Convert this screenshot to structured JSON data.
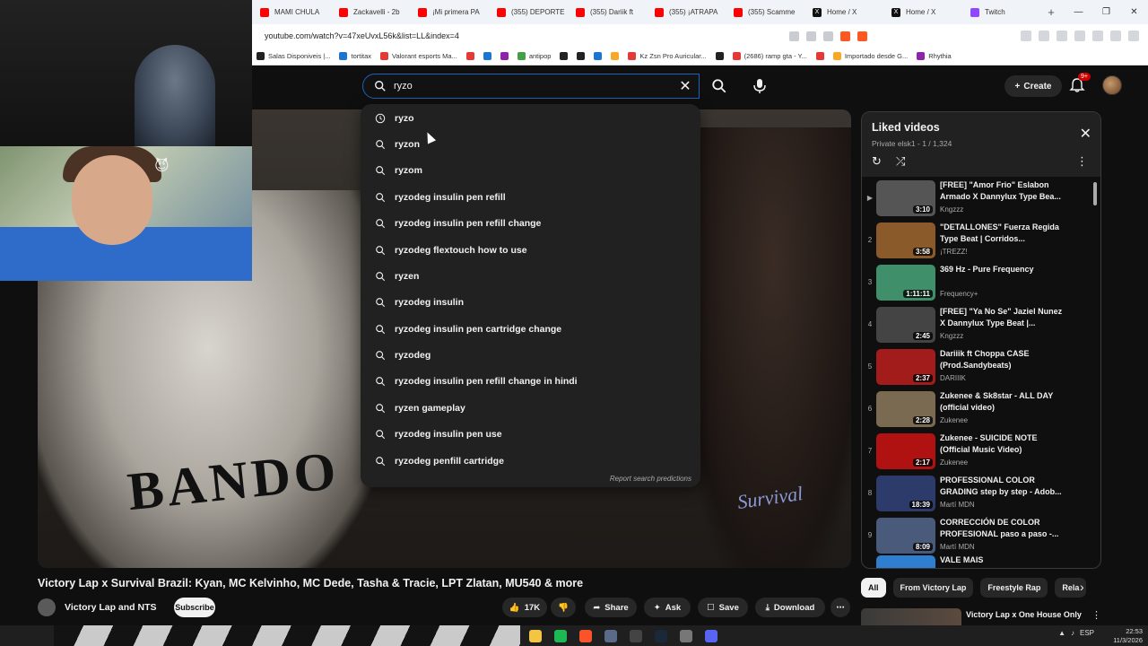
{
  "browser": {
    "tabs": [
      {
        "title": "MAMI CHULA",
        "icon": "youtube"
      },
      {
        "title": "Zackavelli - 2b",
        "icon": "youtube"
      },
      {
        "title": "¡Mi primera PA",
        "icon": "youtube"
      },
      {
        "title": "(355) DEPORTE",
        "icon": "youtube"
      },
      {
        "title": "(355) Dariik ft",
        "icon": "youtube"
      },
      {
        "title": "(355) ¡ATRAPA",
        "icon": "youtube"
      },
      {
        "title": "(355) Scamme",
        "icon": "youtube"
      },
      {
        "title": "Home / X",
        "icon": "x"
      },
      {
        "title": "Home / X",
        "icon": "x"
      },
      {
        "title": "Twitch",
        "icon": "twitch"
      }
    ],
    "new_tab": "+",
    "url": "youtube.com/watch?v=47xeUvxL56k&list=LL&index=4",
    "bookmarks": [
      {
        "label": "Salas Disponiveis |..."
      },
      {
        "label": "tortitax"
      },
      {
        "label": "Valorant esports Ma..."
      },
      {
        "label": "antipop"
      },
      {
        "label": "Kz Zsn Pro Auricular..."
      },
      {
        "label": "(2686) ramp gta - Y..."
      },
      {
        "label": "Importado desde G..."
      },
      {
        "label": "Rhythia"
      }
    ]
  },
  "header": {
    "search_query": "ryzo",
    "create_label": "Create",
    "notif_badge": "9+"
  },
  "suggestions": [
    {
      "text": "ryzo",
      "icon": "history"
    },
    {
      "text": "ryzon",
      "icon": "search"
    },
    {
      "text": "ryzom",
      "icon": "search"
    },
    {
      "text": "ryzodeg insulin pen refill",
      "icon": "search"
    },
    {
      "text": "ryzodeg insulin pen refill change",
      "icon": "search"
    },
    {
      "text": "ryzodeg flextouch how to use",
      "icon": "search"
    },
    {
      "text": "ryzen",
      "icon": "search"
    },
    {
      "text": "ryzodeg insulin",
      "icon": "search"
    },
    {
      "text": "ryzodeg insulin pen cartridge change",
      "icon": "search"
    },
    {
      "text": "ryzodeg",
      "icon": "search"
    },
    {
      "text": "ryzodeg insulin pen refill change in hindi",
      "icon": "search"
    },
    {
      "text": "ryzen gameplay",
      "icon": "search"
    },
    {
      "text": "ryzodeg insulin pen use",
      "icon": "search"
    },
    {
      "text": "ryzodeg penfill cartridge",
      "icon": "search"
    }
  ],
  "report_predictions": "Report search predictions",
  "video": {
    "shirt_text": "BANDO",
    "logo_text": "Survival",
    "title": "Victory Lap x Survival Brazil: Kyan, MC Kelvinho, MC Dede, Tasha & Tracie, LPT Zlatan, MU540 & more",
    "channel": "Victory Lap and NTS",
    "subscribe": "Subscribe",
    "likes": "17K",
    "share": "Share",
    "ask": "Ask",
    "save": "Save",
    "download": "Download"
  },
  "playlist": {
    "title": "Liked videos",
    "subtitle": "Private elsk1 - 1 / 1,324",
    "items": [
      {
        "index": "▶",
        "title": "[FREE] \"Amor Frio\" Eslabon Armado X Dannylux Type Bea...",
        "channel": "Kngzzz",
        "duration": "3:10",
        "thumb": "#555"
      },
      {
        "index": "2",
        "title": "\"DETALLONES\" Fuerza Regida Type Beat | Corridos...",
        "channel": "¡TREZZ!",
        "duration": "3:58",
        "thumb": "#8a5a2b"
      },
      {
        "index": "3",
        "title": "369 Hz - Pure Frequency",
        "channel": "Frequency+",
        "duration": "1:11:11",
        "thumb": "#3f8f6a"
      },
      {
        "index": "4",
        "title": "[FREE] \"Ya No Se\" Jaziel Nunez X Dannylux Type Beat |...",
        "channel": "Kngzzz",
        "duration": "2:45",
        "thumb": "#444"
      },
      {
        "index": "5",
        "title": "Dariiik ft Choppa CASE (Prod.Sandybeats)",
        "channel": "DARIIIK",
        "duration": "2:37",
        "thumb": "#a31c1c"
      },
      {
        "index": "6",
        "title": "Zukenee & Sk8star - ALL DAY (official video)",
        "channel": "Zukenee",
        "duration": "2:28",
        "thumb": "#7a6a52"
      },
      {
        "index": "7",
        "title": "Zukenee - SUICIDE NOTE (Official Music Video)",
        "channel": "Zukenee",
        "duration": "2:17",
        "thumb": "#b01212"
      },
      {
        "index": "8",
        "title": "PROFESSIONAL COLOR GRADING step by step - Adob...",
        "channel": "Martí MDN",
        "duration": "18:39",
        "thumb": "#2d3b6b"
      },
      {
        "index": "9",
        "title": "CORRECCIÓN DE COLOR PROFESIONAL paso a paso -...",
        "channel": "Martí MDN",
        "duration": "8:09",
        "thumb": "#4a5a7a"
      },
      {
        "index": "10",
        "title": "VALE MAIS",
        "channel": "",
        "duration": "",
        "thumb": "#2f7fd1"
      }
    ]
  },
  "chips": [
    "All",
    "From Victory Lap",
    "Freestyle Rap",
    "Rela"
  ],
  "recommended": {
    "title": "Victory Lap x One House Only"
  },
  "taskbar": {
    "lang": "ESP",
    "time": "22:53",
    "date": "11/3/2026"
  },
  "colors": {
    "accent": "#ff0000",
    "search_border": "#1c62b9",
    "bg": "#0f0f0f"
  }
}
